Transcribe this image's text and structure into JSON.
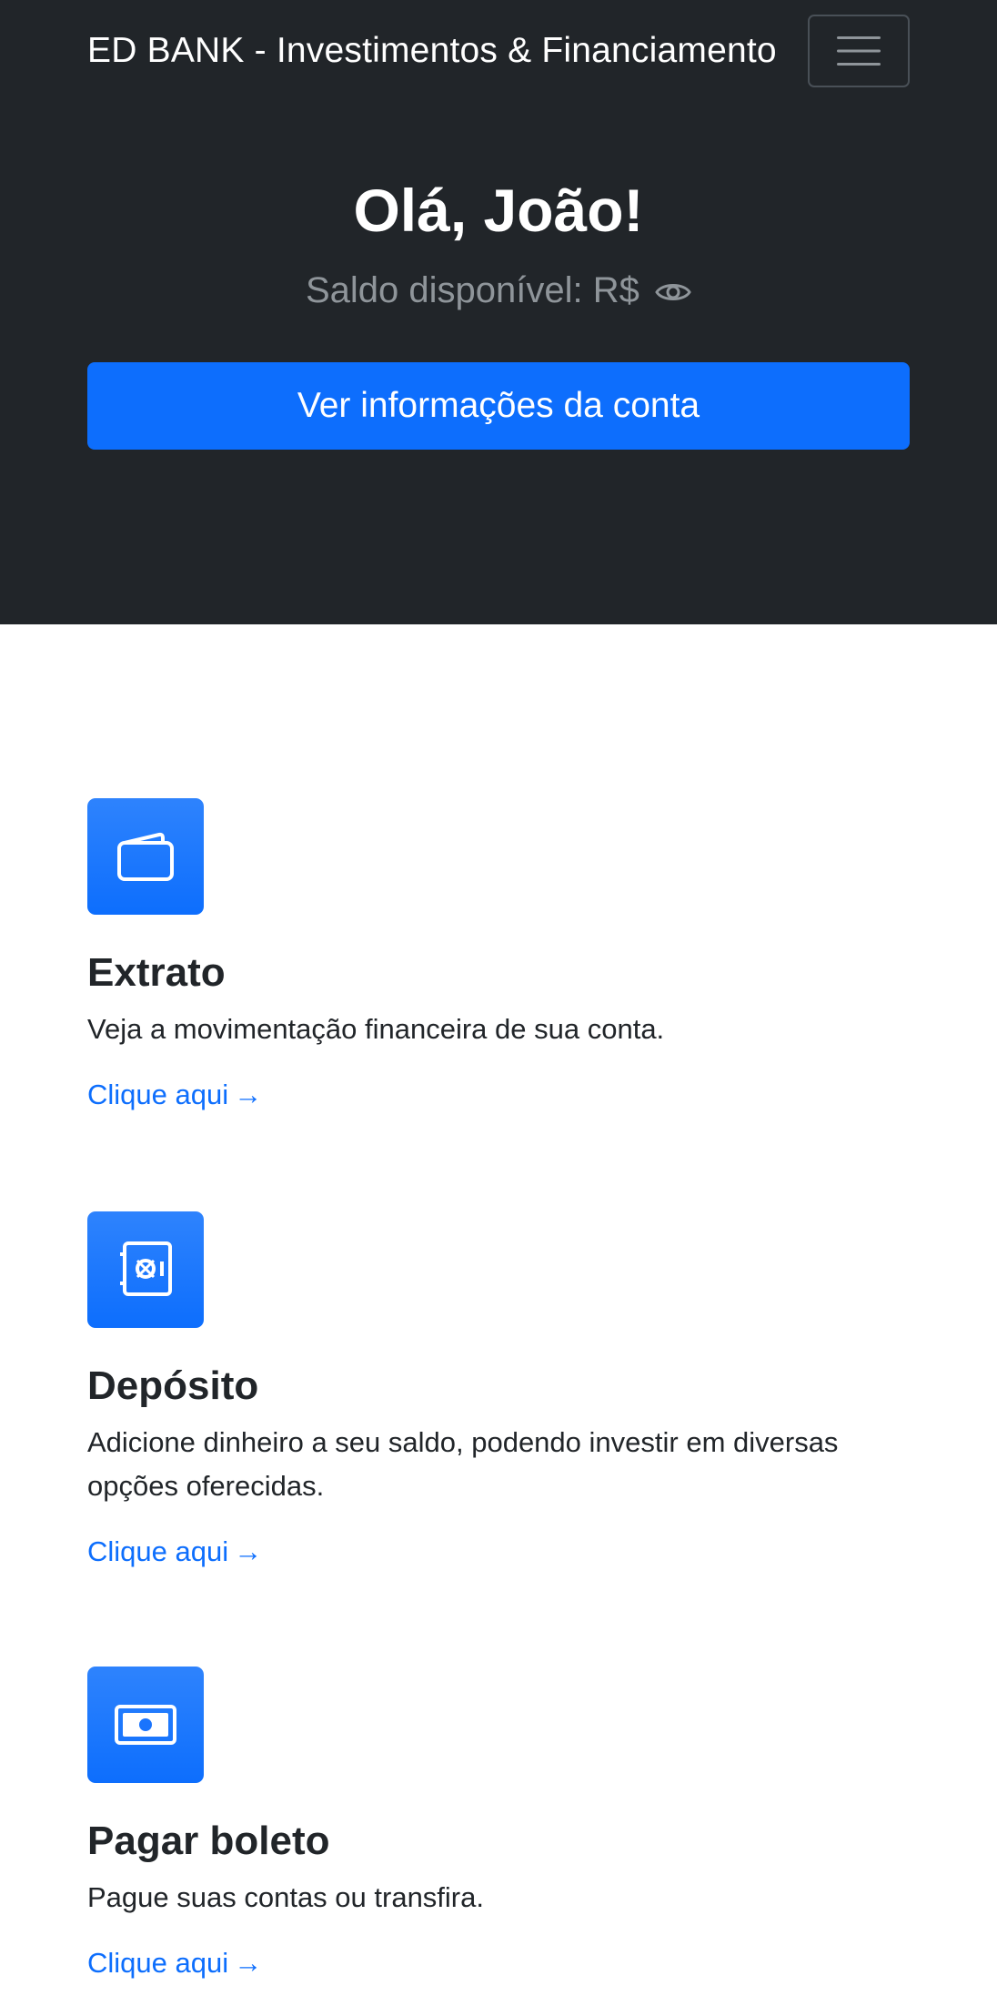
{
  "navbar": {
    "brand": "ED BANK - Investimentos & Financiamento",
    "menu_icon": "hamburger-menu-icon"
  },
  "hero": {
    "greeting": "Olá, João!",
    "balance_label": "Saldo disponível: R$",
    "balance_toggle_icon": "eye-icon",
    "account_button": "Ver informações da conta"
  },
  "features": [
    {
      "icon": "wallet-icon",
      "title": "Extrato",
      "text": "Veja a movimentação financeira de sua conta.",
      "link": "Clique aqui",
      "link_arrow": "→"
    },
    {
      "icon": "safe-icon",
      "title": "Depósito",
      "text": "Adicione dinheiro a seu saldo, podendo investir em diversas opções oferecidas.",
      "link": "Clique aqui",
      "link_arrow": "→"
    },
    {
      "icon": "cash-icon",
      "title": "Pagar boleto",
      "text": "Pague suas contas ou transfira.",
      "link": "Clique aqui",
      "link_arrow": "→"
    }
  ],
  "colors": {
    "dark_background": "#212529",
    "primary": "#0d6efd",
    "muted_text": "#8f959a"
  }
}
